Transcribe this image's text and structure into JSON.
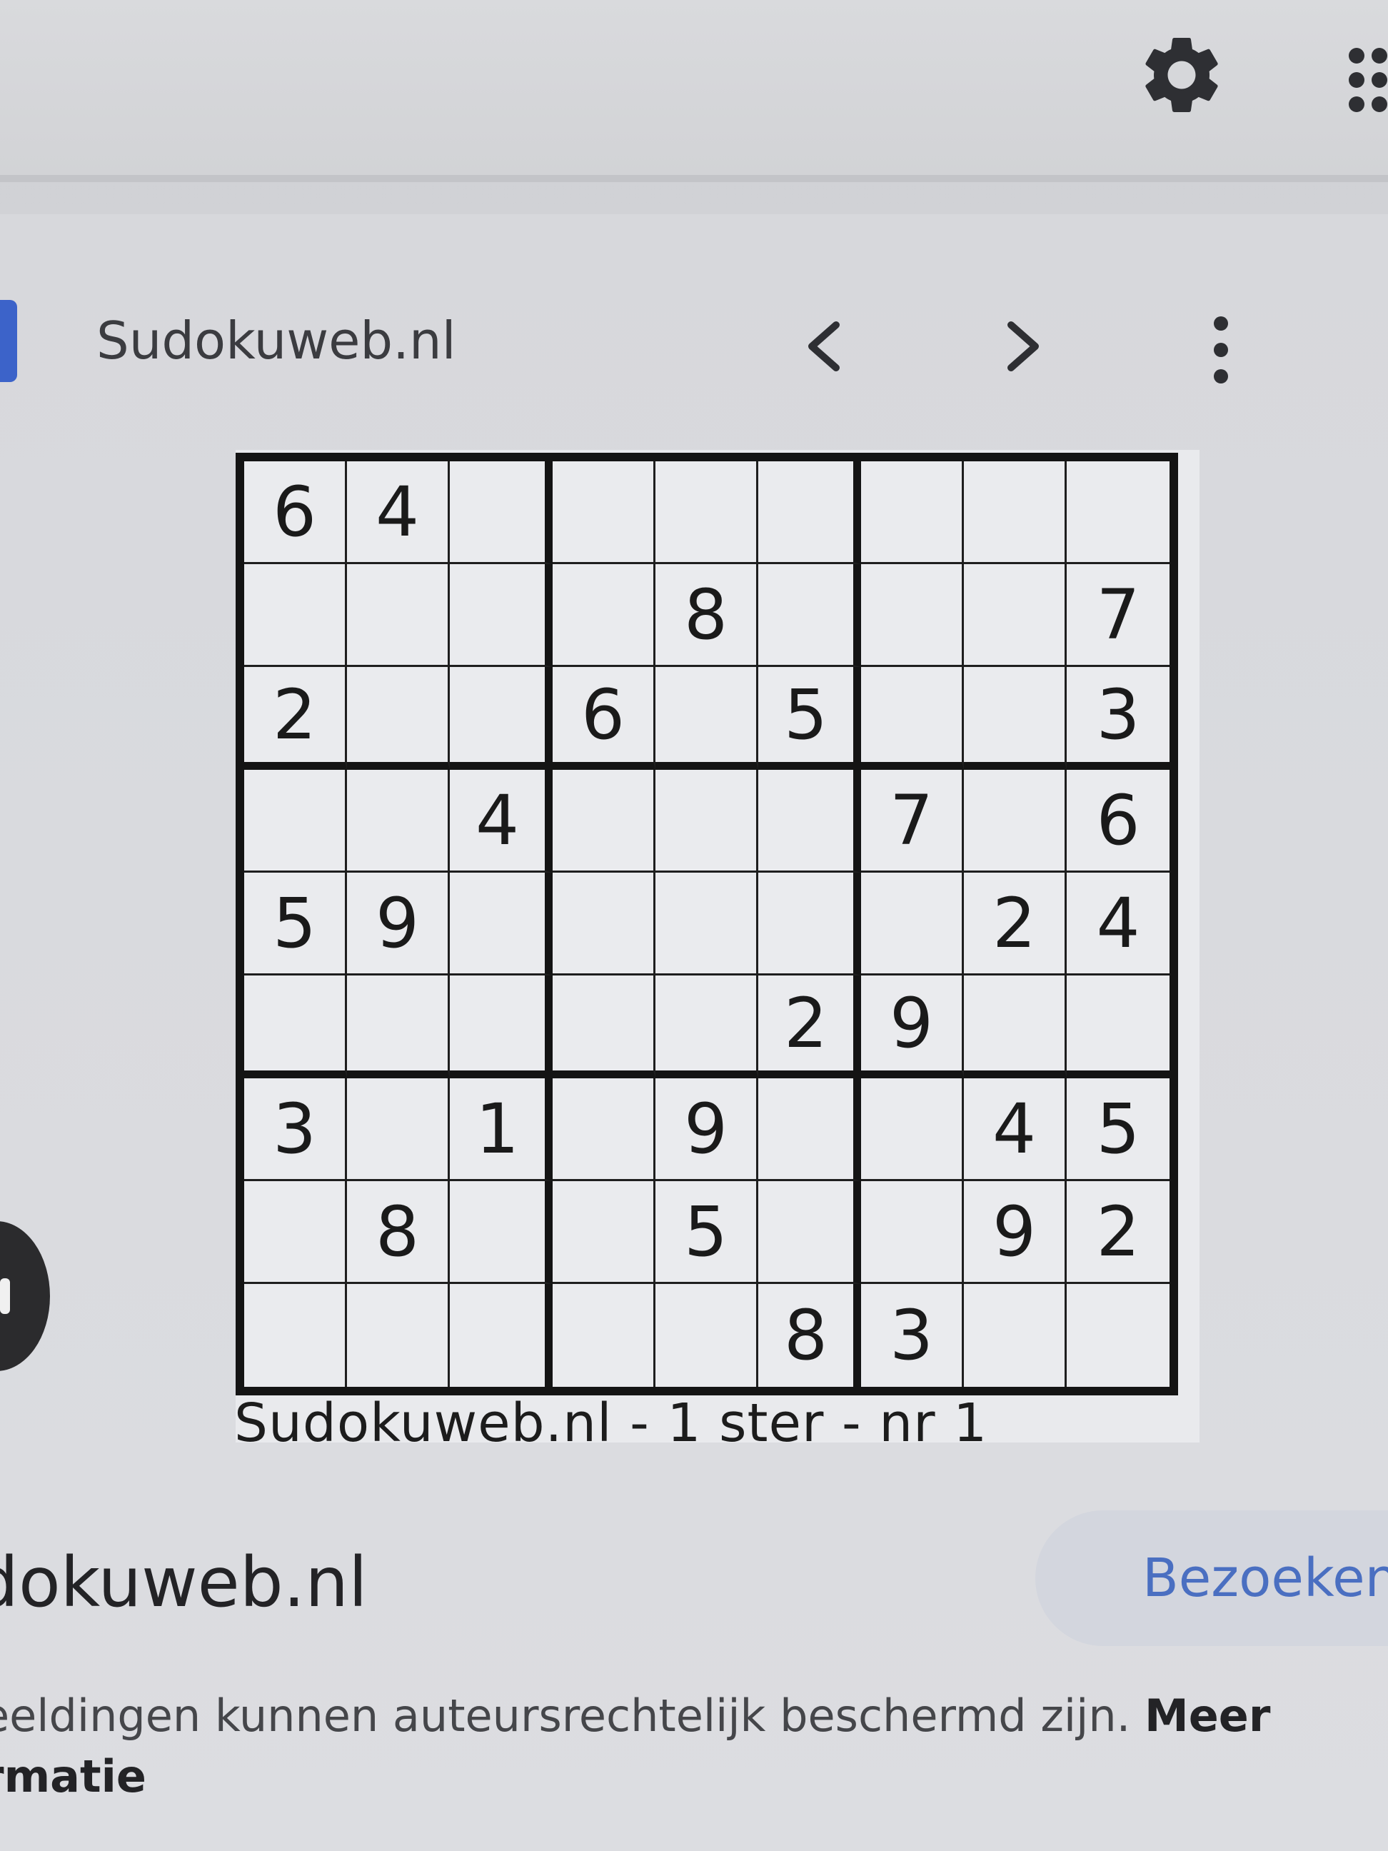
{
  "header": {
    "settings_icon": "gear-icon",
    "apps_icon": "apps-grid-icon"
  },
  "viewer": {
    "site_title": "Sudokuweb.nl",
    "prev_icon": "chevron-left-icon",
    "next_icon": "chevron-right-icon",
    "more_icon": "more-vertical-icon"
  },
  "sudoku": {
    "rows": [
      [
        "6",
        "4",
        "",
        "",
        "",
        "",
        "",
        "",
        ""
      ],
      [
        "",
        "",
        "",
        "",
        "8",
        "",
        "",
        "",
        "7"
      ],
      [
        "2",
        "",
        "",
        "6",
        "",
        "5",
        "",
        "",
        "3"
      ],
      [
        "",
        "",
        "4",
        "",
        "",
        "",
        "7",
        "",
        "6"
      ],
      [
        "5",
        "9",
        "",
        "",
        "",
        "",
        "",
        "2",
        "4"
      ],
      [
        "",
        "",
        "",
        "",
        "",
        "2",
        "9",
        "",
        ""
      ],
      [
        "3",
        "",
        "1",
        "",
        "9",
        "",
        "",
        "4",
        "5"
      ],
      [
        "",
        "8",
        "",
        "",
        "5",
        "",
        "",
        "9",
        "2"
      ],
      [
        "",
        "",
        "",
        "",
        "",
        "8",
        "3",
        "",
        ""
      ]
    ],
    "caption": "Sudokuweb.nl - 1 ster - nr 1"
  },
  "result": {
    "domain": "dokuweb.nl",
    "visit_label": "Bezoeken",
    "notice_text": "eeldingen kunnen auteursrechtelijk beschermd zijn. ",
    "notice_link": "Meer",
    "notice_link_cont": "rmatie"
  },
  "colors": {
    "accent_blue": "#4a6fc1",
    "favicon_blue": "#3c63c9",
    "grid_line": "#141414"
  }
}
